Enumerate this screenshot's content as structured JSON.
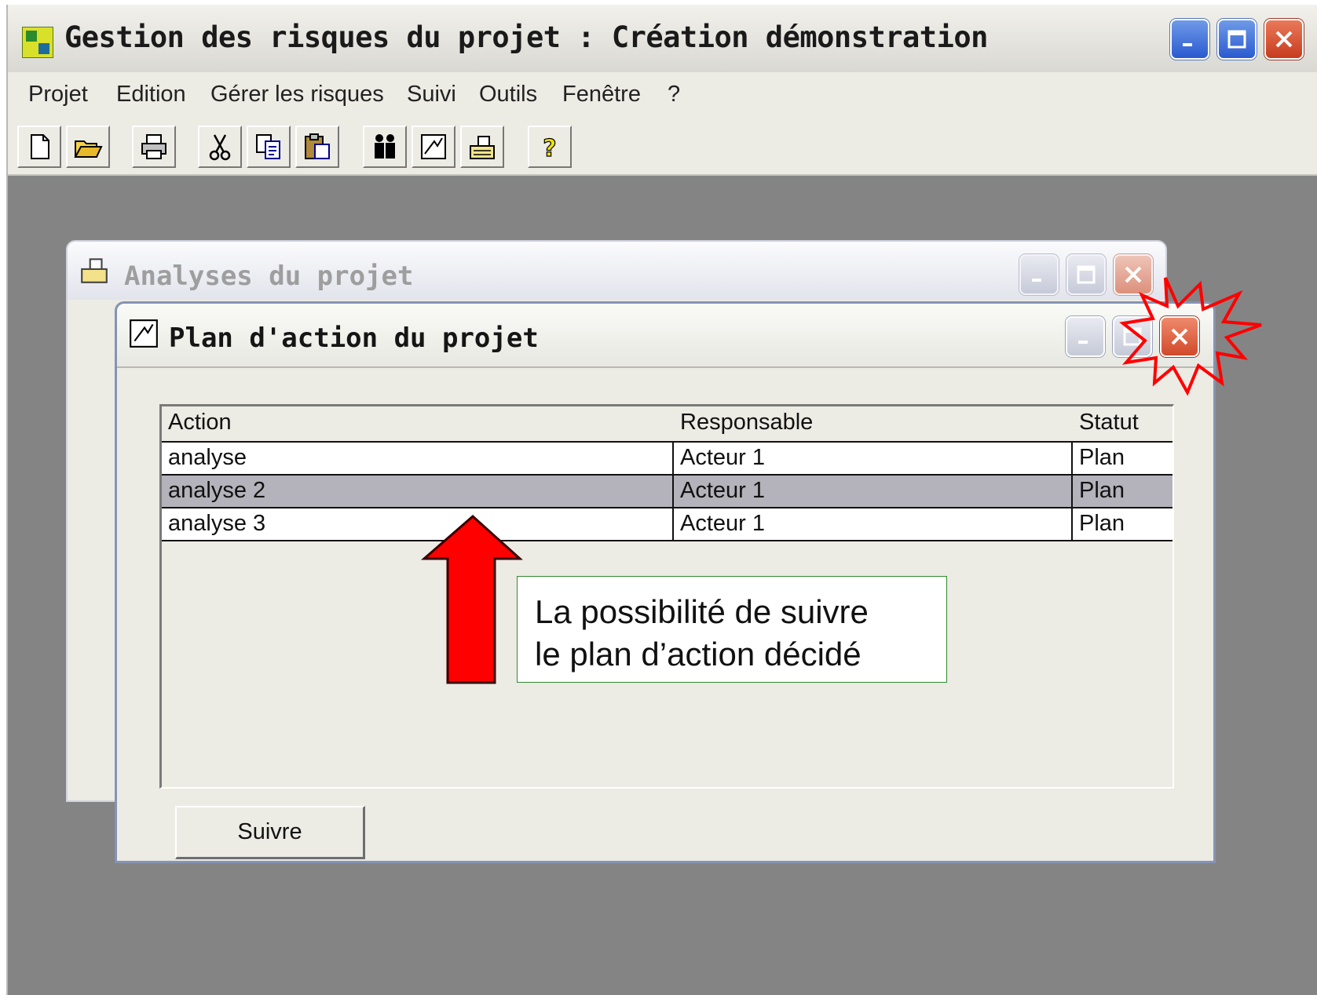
{
  "main_window": {
    "title": "Gestion des risques du projet : Création démonstration",
    "menu": [
      "Projet",
      "Edition",
      "Gérer les risques",
      "Suivi",
      "Outils",
      "Fenêtre",
      "?"
    ],
    "toolbar_icons": [
      "new-document-icon",
      "open-folder-icon",
      "print-icon",
      "cut-icon",
      "copy-icon",
      "paste-icon",
      "users-icon",
      "action-plan-icon",
      "analyses-icon",
      "help-icon"
    ]
  },
  "analyses_window": {
    "title": "Analyses du projet"
  },
  "plan_window": {
    "title": "Plan d'action du projet",
    "columns": [
      "Action",
      "Responsable",
      "Statut"
    ],
    "rows": [
      [
        "analyse",
        "Acteur  1",
        "Plan"
      ],
      [
        "analyse 2",
        "Acteur  1",
        "Plan"
      ],
      [
        "analyse 3",
        "Acteur  1",
        "Plan"
      ]
    ],
    "selected_row": 1,
    "button_label": "Suivre"
  },
  "annotation": {
    "lines": [
      "La possibilité de suivre",
      "le plan d’action décidé"
    ],
    "arrow_color": "#ff0000",
    "border_color": "#2e8b2e"
  }
}
